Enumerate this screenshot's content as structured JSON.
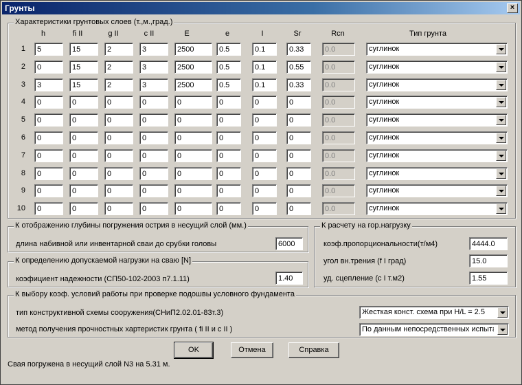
{
  "window": {
    "title": "Грунты",
    "close_label": "×"
  },
  "soil_group": {
    "title": "Характеристики грунтовых слоев (т.,м.,град.)",
    "headers": [
      "h",
      "fi II",
      "g II",
      "c II",
      "E",
      "e",
      "I",
      "Sr",
      "Rcn",
      "Тип грунта"
    ],
    "rows": [
      {
        "num": "1",
        "values": [
          "5",
          "15",
          "2",
          "3",
          "2500",
          "0.5",
          "0.1",
          "0.33"
        ],
        "rcn": "0.0",
        "type": "суглинок"
      },
      {
        "num": "2",
        "values": [
          "0",
          "15",
          "2",
          "3",
          "2500",
          "0.5",
          "0.1",
          "0.55"
        ],
        "rcn": "0.0",
        "type": "суглинок"
      },
      {
        "num": "3",
        "values": [
          "3",
          "15",
          "2",
          "3",
          "2500",
          "0.5",
          "0.1",
          "0.33"
        ],
        "rcn": "0.0",
        "type": "суглинок"
      },
      {
        "num": "4",
        "values": [
          "0",
          "0",
          "0",
          "0",
          "0",
          "0",
          "0",
          "0"
        ],
        "rcn": "0.0",
        "type": "суглинок"
      },
      {
        "num": "5",
        "values": [
          "0",
          "0",
          "0",
          "0",
          "0",
          "0",
          "0",
          "0"
        ],
        "rcn": "0.0",
        "type": "суглинок"
      },
      {
        "num": "6",
        "values": [
          "0",
          "0",
          "0",
          "0",
          "0",
          "0",
          "0",
          "0"
        ],
        "rcn": "0.0",
        "type": "суглинок"
      },
      {
        "num": "7",
        "values": [
          "0",
          "0",
          "0",
          "0",
          "0",
          "0",
          "0",
          "0"
        ],
        "rcn": "0.0",
        "type": "суглинок"
      },
      {
        "num": "8",
        "values": [
          "0",
          "0",
          "0",
          "0",
          "0",
          "0",
          "0",
          "0"
        ],
        "rcn": "0.0",
        "type": "суглинок"
      },
      {
        "num": "9",
        "values": [
          "0",
          "0",
          "0",
          "0",
          "0",
          "0",
          "0",
          "0"
        ],
        "rcn": "0.0",
        "type": "суглинок"
      },
      {
        "num": "10",
        "values": [
          "0",
          "0",
          "0",
          "0",
          "0",
          "0",
          "0",
          "0"
        ],
        "rcn": "0.0",
        "type": "суглинок"
      }
    ]
  },
  "depth_group": {
    "title": "К отображению глубины погружения острия в несущий слой (мм.)",
    "label": "длина набивной или инвентарной сваи до срубки головы",
    "value": "6000"
  },
  "load_group": {
    "title": "К определению допускаемой нагрузки на сваю [N]",
    "label": "коэфициент надежности (СП50-102-2003 п7.1.11)",
    "value": "1.40"
  },
  "horiz_group": {
    "title": "К расчету на гор.нагрузку",
    "fields": [
      {
        "label": "коэф.пропорциональности(т/м4)",
        "value": "4444.0"
      },
      {
        "label": "угол вн.трения (f I град)",
        "value": "15.0"
      },
      {
        "label": "уд. сцепление  (c I т.м2)",
        "value": "1.55"
      }
    ]
  },
  "work_group": {
    "title": "К выбору коэф. условий работы при проверке подошвы условного фундамента",
    "scheme_label": "тип конструктивной схемы сооружения(СНиП2.02.01-83т.3)",
    "scheme_value": "Жесткая конст. схема при H/L  = 2.5",
    "method_label": "метод получения прочностных хартеристик грунта ( fi II и c II )",
    "method_value": "По данным непосредственных испытаний"
  },
  "buttons": {
    "ok": "OK",
    "cancel": "Отмена",
    "help": "Справка"
  },
  "status": "Свая погружена в несущий слой N3 на 5.31 м."
}
